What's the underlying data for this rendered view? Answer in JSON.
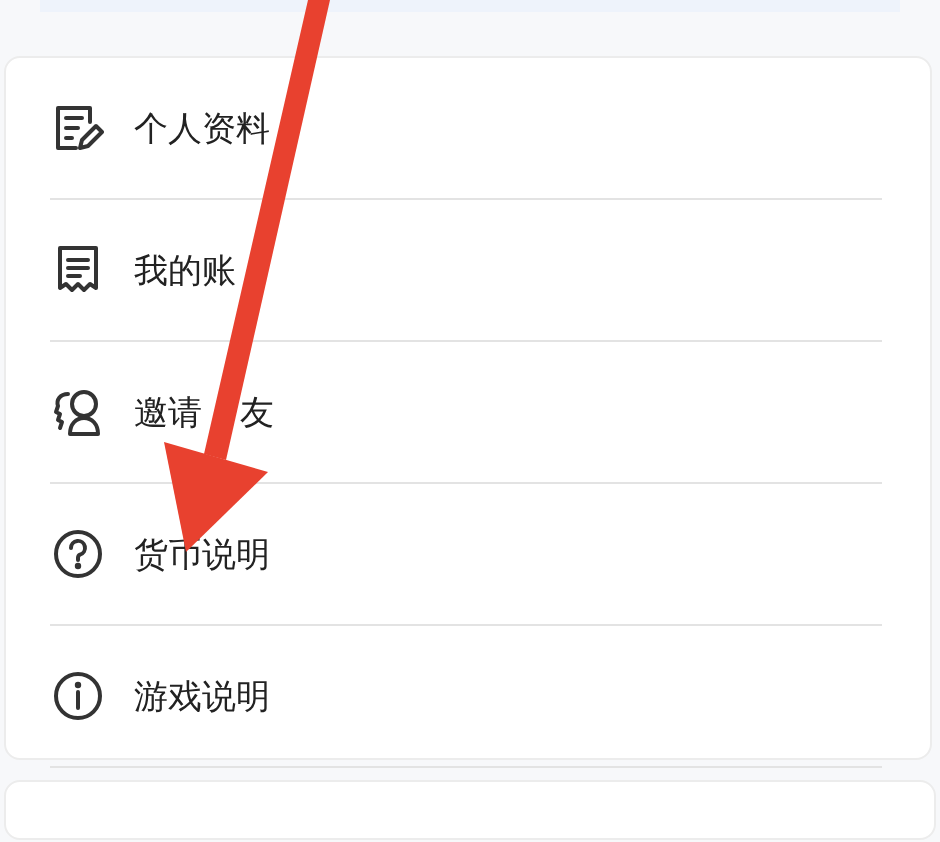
{
  "menu": {
    "items": [
      {
        "kind": "profile",
        "label": "个人资料"
      },
      {
        "kind": "bill",
        "label": "我的账"
      },
      {
        "kind": "invite",
        "label": "邀请",
        "label_after": "友"
      },
      {
        "kind": "question",
        "label": "货币说明"
      },
      {
        "kind": "info",
        "label": "游戏说明"
      }
    ]
  },
  "annotation": {
    "kind": "arrow"
  }
}
